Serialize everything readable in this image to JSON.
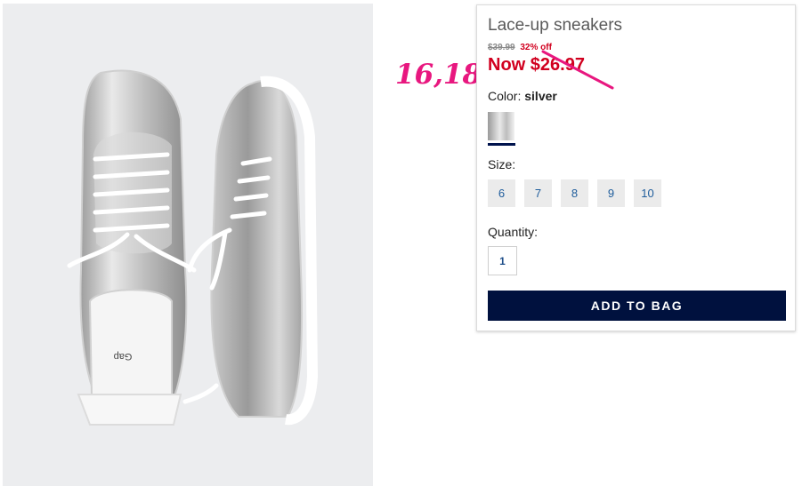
{
  "product": {
    "title": "Lace-up sneakers",
    "original_price": "$39.99",
    "discount": "32% off",
    "now_price": "Now $26.97",
    "color_label": "Color:",
    "color_value": "silver",
    "size_label": "Size:",
    "sizes": [
      "6",
      "7",
      "8",
      "9",
      "10"
    ],
    "quantity_label": "Quantity:",
    "quantity_value": "1",
    "add_button": "ADD TO BAG",
    "insole_brand": "Gap"
  },
  "annotation": {
    "text": "16,18",
    "color": "#e8177f"
  },
  "colors": {
    "accent_navy": "#00113e",
    "sale_red": "#d1001f",
    "size_text": "#1f5d9c"
  }
}
